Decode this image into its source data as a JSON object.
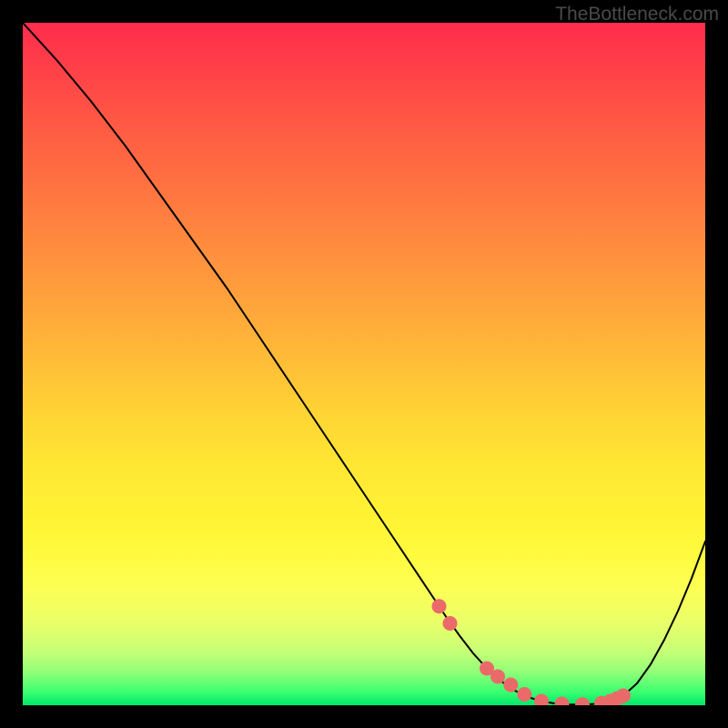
{
  "watermark": "TheBottleneck.com",
  "chart_data": {
    "type": "line",
    "title": "",
    "xlabel": "",
    "ylabel": "",
    "xlim": [
      0,
      100
    ],
    "ylim": [
      0,
      100
    ],
    "grid": false,
    "legend": false,
    "series": [
      {
        "name": "bottleneck-curve",
        "color": "#000000",
        "stroke_width": 2,
        "x": [
          0,
          5,
          10,
          15,
          20,
          25,
          30,
          35,
          40,
          45,
          50,
          55,
          60,
          62,
          64,
          66,
          68,
          70,
          72,
          74,
          76,
          78,
          80,
          82,
          84,
          86,
          88,
          90,
          92,
          94,
          96,
          98,
          100
        ],
        "y": [
          100,
          94.5,
          88.5,
          82.0,
          75.0,
          68.0,
          61.0,
          53.5,
          46.0,
          38.5,
          31.0,
          23.5,
          16.0,
          13.0,
          10.2,
          7.6,
          5.4,
          3.6,
          2.2,
          1.2,
          0.6,
          0.25,
          0.1,
          0.1,
          0.2,
          0.5,
          1.4,
          3.2,
          6.0,
          9.6,
          13.8,
          18.6,
          24.0
        ]
      },
      {
        "name": "highlight-points",
        "color": "#ea6a6a",
        "marker_radius": 8,
        "x": [
          61.0,
          62.6,
          68.0,
          69.6,
          71.5,
          73.5,
          76.0,
          79.0,
          82.0,
          84.8,
          86.1,
          87.1,
          88.0
        ],
        "y": [
          14.5,
          12.0,
          5.4,
          4.2,
          3.0,
          1.6,
          0.6,
          0.2,
          0.1,
          0.3,
          0.6,
          1.0,
          1.4
        ]
      }
    ],
    "background_gradient": {
      "direction": "vertical",
      "stops": [
        {
          "pos": 0.0,
          "color": "#ff2c4d"
        },
        {
          "pos": 0.5,
          "color": "#ffbe37"
        },
        {
          "pos": 0.8,
          "color": "#fcff55"
        },
        {
          "pos": 1.0,
          "color": "#00e86a"
        }
      ]
    }
  }
}
